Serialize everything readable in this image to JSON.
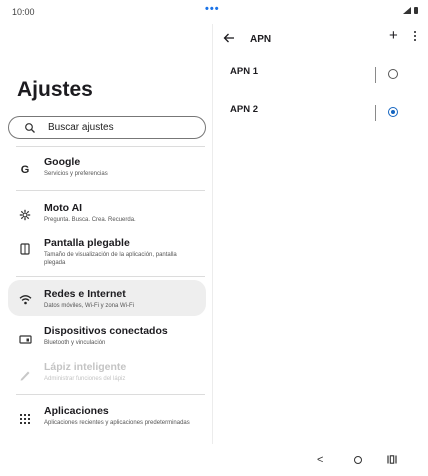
{
  "status_bar": {
    "time": "10:00",
    "dots": "•••"
  },
  "settings": {
    "title": "Ajustes",
    "search_placeholder": "Buscar ajustes",
    "items": [
      {
        "title": "Google",
        "subtitle": "Servicios y preferencias",
        "icon": "google-icon"
      },
      {
        "title": "Moto AI",
        "subtitle": "Pregunta. Busca. Crea. Recuerda.",
        "icon": "moto-ai-icon"
      },
      {
        "title": "Pantalla plegable",
        "subtitle": "Tamaño de visualización de la aplicación, pantalla plegada",
        "icon": "foldable-icon"
      },
      {
        "title": "Redes e Internet",
        "subtitle": "Datos móviles, Wi-Fi y zona Wi-Fi",
        "icon": "wifi-icon",
        "selected": true
      },
      {
        "title": "Dispositivos conectados",
        "subtitle": "Bluetooth y vinculación",
        "icon": "devices-icon"
      },
      {
        "title": "Lápiz inteligente",
        "subtitle": "Administrar funciones del lápiz",
        "icon": "pen-icon",
        "disabled": true
      },
      {
        "title": "Aplicaciones",
        "subtitle": "Aplicaciones recientes y aplicaciones predeterminadas",
        "icon": "apps-grid-icon"
      }
    ]
  },
  "apn_panel": {
    "title": "APN",
    "add_label": "+",
    "apns": [
      {
        "name": "APN 1",
        "selected": false
      },
      {
        "name": "APN 2",
        "selected": true
      }
    ]
  },
  "nav_bar": {
    "back_glyph": "<"
  },
  "colors": {
    "accent": "#1565c0",
    "selected_bg": "#eeeeee",
    "disabled_text": "#c4c4c4"
  }
}
